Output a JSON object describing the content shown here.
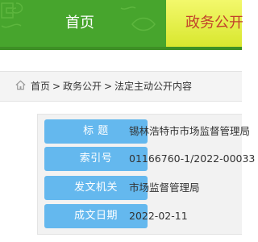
{
  "nav": {
    "items": [
      {
        "label": "首页"
      },
      {
        "label": "政务公开"
      }
    ]
  },
  "breadcrumb": {
    "items": [
      "首页",
      "政务公开",
      "法定主动公开内容"
    ],
    "separator": ">"
  },
  "info": {
    "rows": [
      {
        "label": "标 题",
        "value": "锡林浩特市市场监督管理局"
      },
      {
        "label": "索引号",
        "value": "01166760-1/2022-00033"
      },
      {
        "label": "发文机关",
        "value": "市场监督管理局"
      },
      {
        "label": "成文日期",
        "value": "2022-02-11"
      }
    ]
  },
  "colors": {
    "nav_green": "#47a52d",
    "nav_active_bg": "#e6ef45",
    "nav_active_text": "#c2422b",
    "label_blue": "#64b8ee"
  }
}
